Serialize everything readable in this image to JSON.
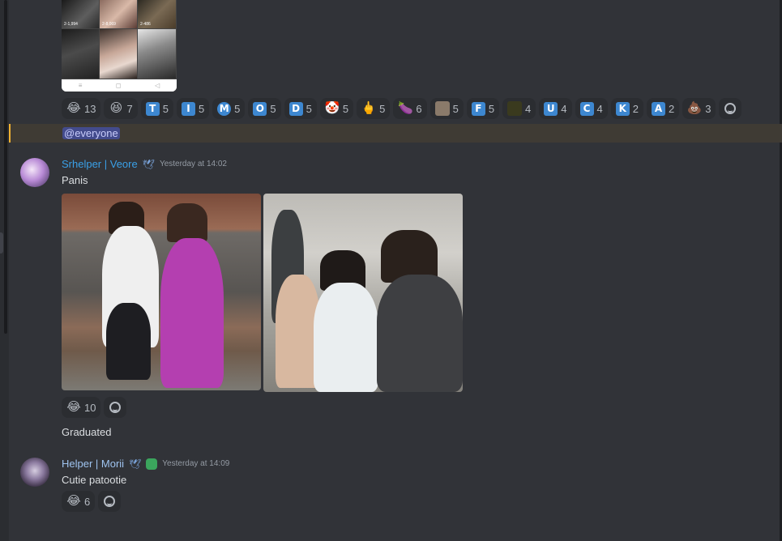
{
  "top_image": {
    "captions": [
      "2-1,994",
      "2-8,069",
      "2-486"
    ],
    "nav_icons": [
      "≡",
      "◻",
      "◁"
    ]
  },
  "reactions_row1": [
    {
      "kind": "emoji",
      "icon": "😂",
      "name": "joy",
      "count": "13"
    },
    {
      "kind": "emoji",
      "icon": "😆",
      "name": "laughing",
      "count": "7"
    },
    {
      "kind": "letter",
      "icon": "T",
      "count": "5"
    },
    {
      "kind": "letter",
      "icon": "I",
      "count": "5"
    },
    {
      "kind": "letter",
      "icon": "M",
      "circle": true,
      "count": "5"
    },
    {
      "kind": "letter",
      "icon": "O",
      "count": "5"
    },
    {
      "kind": "letter",
      "icon": "D",
      "count": "5"
    },
    {
      "kind": "emoji",
      "icon": "🤡",
      "name": "clown",
      "count": "5"
    },
    {
      "kind": "emoji",
      "icon": "🖕",
      "name": "middle-finger",
      "count": "5"
    },
    {
      "kind": "emoji",
      "icon": "🍆",
      "name": "eggplant",
      "count": "6"
    },
    {
      "kind": "img",
      "color": "#8a7a6a",
      "name": "custom-face",
      "count": "5"
    },
    {
      "kind": "letter",
      "icon": "F",
      "count": "5"
    },
    {
      "kind": "img",
      "color": "#3a3a1e",
      "name": "custom-dark",
      "count": "4"
    },
    {
      "kind": "letter",
      "icon": "U",
      "count": "4"
    },
    {
      "kind": "letter",
      "icon": "C",
      "count": "4"
    },
    {
      "kind": "letter",
      "icon": "K",
      "count": "2"
    },
    {
      "kind": "letter",
      "icon": "A",
      "count": "2"
    },
    {
      "kind": "emoji",
      "icon": "💩",
      "name": "poop",
      "count": "3"
    }
  ],
  "mention": "@everyone",
  "message1": {
    "username": "Srhelper | Veore",
    "badge_icon": "🕊",
    "timestamp": "Yesterday at 14:02",
    "text": "Panis",
    "reaction": {
      "icon": "😂",
      "count": "10"
    },
    "followup": "Graduated"
  },
  "message2": {
    "username": "Helper | Morii",
    "badge_icon": "🕊",
    "timestamp": "Yesterday at 14:09",
    "text": "Cutie patootie",
    "reaction": {
      "icon": "😂",
      "count": "6"
    }
  }
}
